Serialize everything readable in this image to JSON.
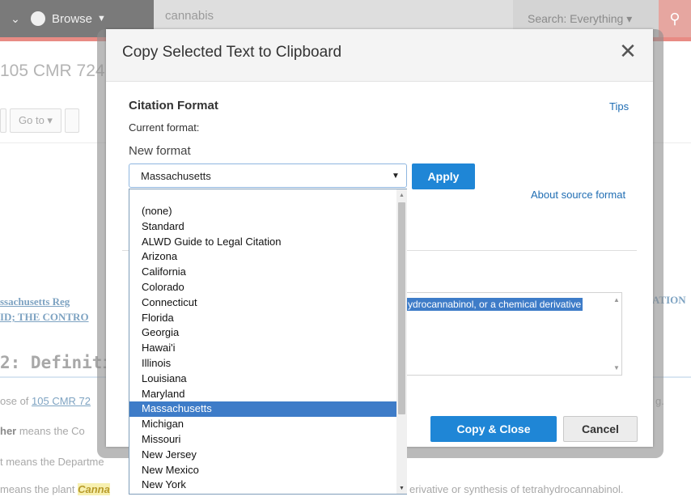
{
  "colors": {
    "primary": "#1f86d6",
    "link": "#1f6db3",
    "selection": "#3e7cc8",
    "brand_red": "#e88b84"
  },
  "app": {
    "browse_label": "Browse",
    "search_value": "cannabis",
    "search_scope": "Search: Everything",
    "doc_title": "105 CMR 724",
    "goto_label": "Go to",
    "reg_link_line1": "ssachusetts Reg",
    "reg_link_line2": "ID; THE CONTRO",
    "right_link_fragment": "ATION",
    "def_heading": "2: Definitio",
    "line1_prefix": "ose of ",
    "line1_link": "105 CMR 72",
    "line1_suffix": "g.",
    "line2_bold": "her",
    "line2_text": " means the Co",
    "line3_text": "t means the Departme",
    "line4_prefix": "means the plant ",
    "line4_highlight": "Canna",
    "line4_suffix": "erivative or synthesis of tetrahydrocannabinol."
  },
  "modal": {
    "title": "Copy Selected Text to Clipboard",
    "section_title": "Citation Format",
    "tips": "Tips",
    "current_format_label": "Current format:",
    "new_format_label": "New format",
    "selected_format": "Massachusetts",
    "apply": "Apply",
    "about_source": "About source format",
    "link_fragment": ".",
    "selected_text": "ydrocannabinol, or a chemical derivative",
    "copy_close": "Copy & Close",
    "cancel": "Cancel"
  },
  "dropdown": {
    "options": [
      "(none)",
      "Standard",
      "ALWD Guide to Legal Citation",
      "Arizona",
      "California",
      "Colorado",
      "Connecticut",
      "Florida",
      "Georgia",
      "Hawai'i",
      "Illinois",
      "Louisiana",
      "Maryland",
      "Massachusetts",
      "Michigan",
      "Missouri",
      "New Jersey",
      "New Mexico",
      "New York"
    ],
    "selected": "Massachusetts"
  }
}
